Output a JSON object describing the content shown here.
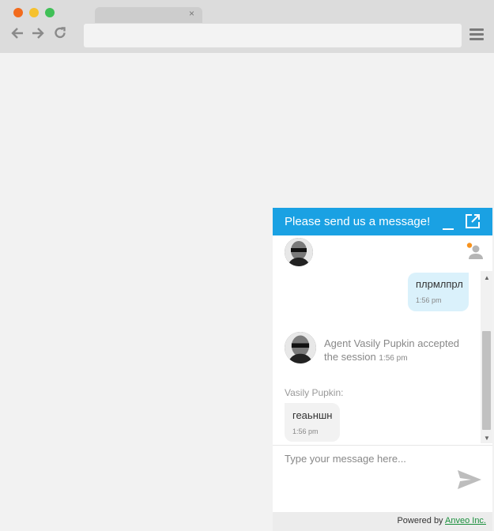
{
  "browser": {
    "tab_close": "×",
    "back_icon": "arrow-left",
    "forward_icon": "arrow-right",
    "reload_icon": "reload",
    "menu_icon": "hamburger",
    "address_value": ""
  },
  "chat": {
    "header_title": "Please send us a message!",
    "accent_color": "#1aa1e3",
    "messages": [
      {
        "type": "outgoing",
        "text": "плрмлпрл",
        "time": "1:56 pm"
      },
      {
        "type": "system",
        "text": "Agent Vasily Pupkin accepted the session",
        "time": "1:56 pm"
      },
      {
        "type": "incoming",
        "sender": "Vasily Pupkin:",
        "text": "геаьншн",
        "time": "1:56 pm"
      }
    ],
    "input_placeholder": "Type your message here...",
    "powered_by_prefix": "Powered by",
    "powered_by_link": "Anveo Inc."
  }
}
